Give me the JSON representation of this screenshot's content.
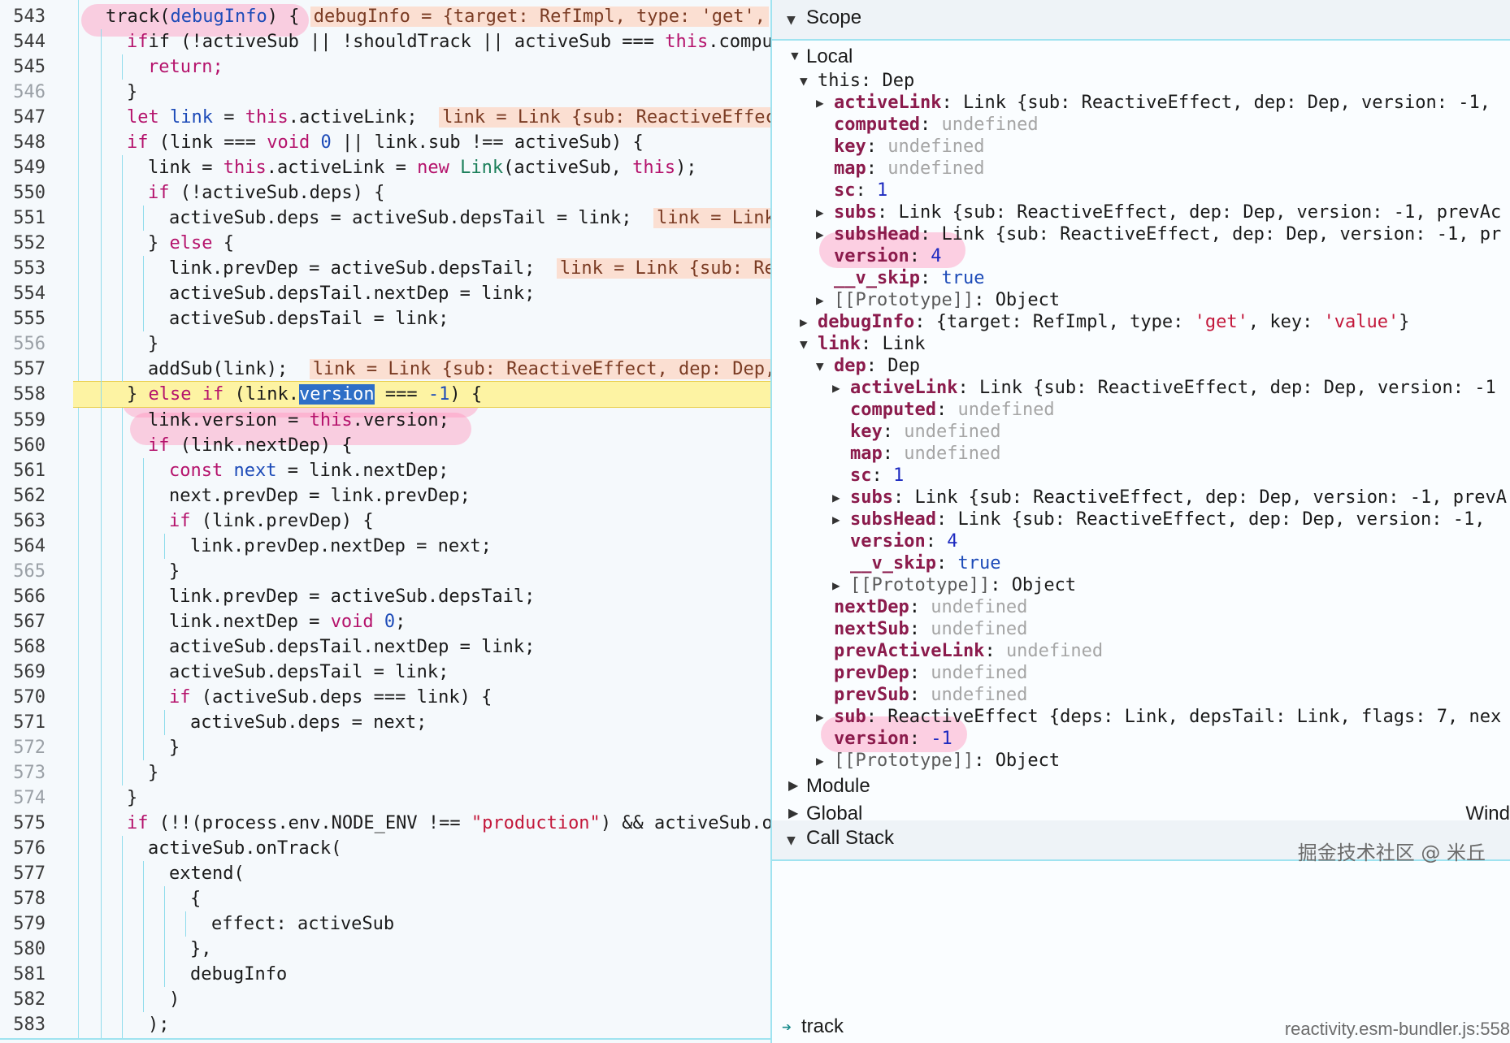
{
  "code": {
    "lines": [
      {
        "num": "543"
      },
      {
        "num": "544"
      },
      {
        "num": "545"
      },
      {
        "num": "546"
      },
      {
        "num": "547"
      },
      {
        "num": "548"
      },
      {
        "num": "549"
      },
      {
        "num": "550"
      },
      {
        "num": "551"
      },
      {
        "num": "552"
      },
      {
        "num": "553"
      },
      {
        "num": "554"
      },
      {
        "num": "555"
      },
      {
        "num": "556"
      },
      {
        "num": "557"
      },
      {
        "num": "558"
      },
      {
        "num": "559"
      },
      {
        "num": "560"
      },
      {
        "num": "561"
      },
      {
        "num": "562"
      },
      {
        "num": "563"
      },
      {
        "num": "564"
      },
      {
        "num": "565"
      },
      {
        "num": "566"
      },
      {
        "num": "567"
      },
      {
        "num": "568"
      },
      {
        "num": "569"
      },
      {
        "num": "570"
      },
      {
        "num": "571"
      },
      {
        "num": "572"
      },
      {
        "num": "573"
      },
      {
        "num": "574"
      },
      {
        "num": "575"
      },
      {
        "num": "576"
      },
      {
        "num": "577"
      },
      {
        "num": "578"
      },
      {
        "num": "579"
      },
      {
        "num": "580"
      },
      {
        "num": "581"
      },
      {
        "num": "582"
      },
      {
        "num": "583"
      }
    ],
    "l543_a": "track(",
    "l543_b": "debugInfo",
    "l543_c": ") {",
    "l543_inline": "debugInfo = {target: RefImpl, type: 'get',",
    "l544_a": "if (!activeSub || !shouldTrack || activeSub === ",
    "l544_this": "this",
    "l544_b": ".compute",
    "l545": "return;",
    "l546": "}",
    "l547_let": "let",
    "l547_link": "link",
    "l547_a": " = ",
    "l547_this": "this",
    "l547_b": ".activeLink;",
    "l547_inline": "link = Link {sub: ReactiveEffec",
    "l548_if": "if",
    "l548_a": " (link === ",
    "l548_void": "void",
    "l548_zero": "0",
    "l548_b": " || link.sub !== activeSub) {",
    "l549_a": "link = ",
    "l549_this": "this",
    "l549_b": ".activeLink = ",
    "l549_new": "new",
    "l549_cls": "Link",
    "l549_c": "(activeSub, ",
    "l549_this2": "this",
    "l549_d": ");",
    "l550_if": "if",
    "l550_a": " (!activeSub.deps) {",
    "l551_a": "activeSub.deps = activeSub.depsTail = link;",
    "l551_inline": "link = Link",
    "l552_a": "} ",
    "l552_else": "else",
    "l552_b": " {",
    "l553_a": "link.prevDep = activeSub.depsTail;",
    "l553_inline": "link = Link {sub: Re",
    "l554": "activeSub.depsTail.nextDep = link;",
    "l555": "activeSub.depsTail = link;",
    "l556": "}",
    "l557_a": "addSub(link);",
    "l557_inline": "link = Link {sub: ReactiveEffect, dep: Dep,",
    "l558_a": "} ",
    "l558_else": "else",
    "l558_if": "if",
    "l558_b": " (link.",
    "l558_sel": "version",
    "l558_c": " === ",
    "l558_num": "-1",
    "l558_d": ") {",
    "l559_a": "link.version = ",
    "l559_this": "this",
    "l559_b": ".version;",
    "l560_if": "if",
    "l560_a": " (link.nextDep) {",
    "l561_const": "const",
    "l561_next": "next",
    "l561_a": " = link.nextDep;",
    "l562": "next.prevDep = link.prevDep;",
    "l563_if": "if",
    "l563_a": " (link.prevDep) {",
    "l564": "link.prevDep.nextDep = next;",
    "l565": "}",
    "l566": "link.prevDep = activeSub.depsTail;",
    "l567_a": "link.nextDep = ",
    "l567_void": "void",
    "l567_zero": "0",
    "l567_b": ";",
    "l568": "activeSub.depsTail.nextDep = link;",
    "l569": "activeSub.depsTail = link;",
    "l570_if": "if",
    "l570_a": " (activeSub.deps === link) {",
    "l571": "activeSub.deps = next;",
    "l572": "}",
    "l573": "}",
    "l574": "}",
    "l575_if": "if",
    "l575_a": " (!!(process.env.NODE_ENV !== ",
    "l575_str": "\"production\"",
    "l575_b": ") && activeSub.o",
    "l576": "activeSub.onTrack(",
    "l577": "extend(",
    "l578": "{",
    "l579": "effect: activeSub",
    "l580": "},",
    "l581": "debugInfo",
    "l582": ")",
    "l583": ");"
  },
  "scope": {
    "header": "Scope",
    "local": "Local",
    "this_key": "this",
    "this_val": "Dep",
    "activeLink_key": "activeLink",
    "activeLink_val": "Link {sub: ReactiveEffect, dep: Dep, version: -1,",
    "computed_key": "computed",
    "undefined": "undefined",
    "key_key": "key",
    "map_key": "map",
    "sc_key": "sc",
    "sc_val": "1",
    "subs_key": "subs",
    "subs_val": "Link {sub: ReactiveEffect, dep: Dep, version: -1, prevAc",
    "subsHead_key": "subsHead",
    "subsHead_val": "Link {sub: ReactiveEffect, dep: Dep, version: -1, pr",
    "version_key": "version",
    "version_val": "4",
    "vskip_key": "__v_skip",
    "vskip_val": "true",
    "proto_key": "[[Prototype]]",
    "proto_val": "Object",
    "debugInfo_key": "debugInfo",
    "debugInfo_a": "{target: RefImpl, type: ",
    "debugInfo_s1": "'get'",
    "debugInfo_b": ", key: ",
    "debugInfo_s2": "'value'",
    "debugInfo_c": "}",
    "link_key": "link",
    "link_val": "Link",
    "dep_key": "dep",
    "dep_val": "Dep",
    "activeLink2_val": "Link {sub: ReactiveEffect, dep: Dep, version: -1",
    "subs2_val": "Link {sub: ReactiveEffect, dep: Dep, version: -1, prevA",
    "subsHead2_val": "Link {sub: ReactiveEffect, dep: Dep, version: -1,",
    "nextDep_key": "nextDep",
    "nextSub_key": "nextSub",
    "prevActiveLink_key": "prevActiveLink",
    "prevDep_key": "prevDep",
    "prevSub_key": "prevSub",
    "sub_key": "sub",
    "sub_val": "ReactiveEffect {deps: Link, depsTail: Link, flags: 7, nex",
    "linkversion_val": "-1",
    "module": "Module",
    "global": "Global",
    "global_right": "Wind",
    "callstack": "Call Stack",
    "frame_name": "track",
    "frame_loc": "reactivity.esm-bundler.js:558"
  },
  "watermark": "掘金技术社区 @ 米丘"
}
